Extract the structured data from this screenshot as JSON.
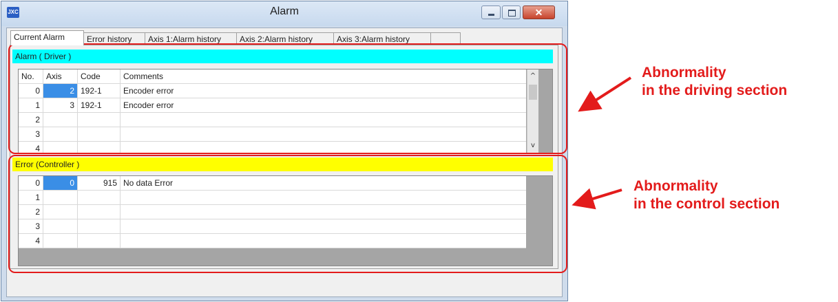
{
  "window": {
    "title": "Alarm",
    "app_icon_text": "JXC",
    "close_glyph": "✕"
  },
  "tabs": [
    {
      "label": "Current Alarm",
      "active": true
    },
    {
      "label": "Error history",
      "active": false
    },
    {
      "label": "Axis 1:Alarm history",
      "active": false
    },
    {
      "label": "Axis 2:Alarm history",
      "active": false
    },
    {
      "label": "Axis 3:Alarm history",
      "active": false
    },
    {
      "label": "",
      "active": false
    }
  ],
  "driver_panel": {
    "band_label": "Alarm ( Driver )",
    "band_color": "#00ffff",
    "columns": [
      "No.",
      "Axis",
      "Code",
      "Comments"
    ],
    "rows": [
      {
        "no": "0",
        "axis": "2",
        "code": "192-1",
        "comment": "Encoder error"
      },
      {
        "no": "1",
        "axis": "3",
        "code": "192-1",
        "comment": "Encoder error"
      },
      {
        "no": "2",
        "axis": "",
        "code": "",
        "comment": ""
      },
      {
        "no": "3",
        "axis": "",
        "code": "",
        "comment": ""
      },
      {
        "no": "4",
        "axis": "",
        "code": "",
        "comment": ""
      }
    ],
    "scroll_up": "^",
    "scroll_down": "v"
  },
  "controller_panel": {
    "band_label": "Error (Controller )",
    "band_color": "#ffff00",
    "rows": [
      {
        "no": "0",
        "axis": "0",
        "code": "915",
        "comment": "No data Error"
      },
      {
        "no": "1",
        "axis": "",
        "code": "",
        "comment": ""
      },
      {
        "no": "2",
        "axis": "",
        "code": "",
        "comment": ""
      },
      {
        "no": "3",
        "axis": "",
        "code": "",
        "comment": ""
      },
      {
        "no": "4",
        "axis": "",
        "code": "",
        "comment": ""
      }
    ]
  },
  "annotations": {
    "driving": {
      "line1": "Abnormality",
      "line2": "in the driving section"
    },
    "control": {
      "line1": "Abnormality",
      "line2": "in the control section"
    },
    "color": "#e31b1b"
  }
}
